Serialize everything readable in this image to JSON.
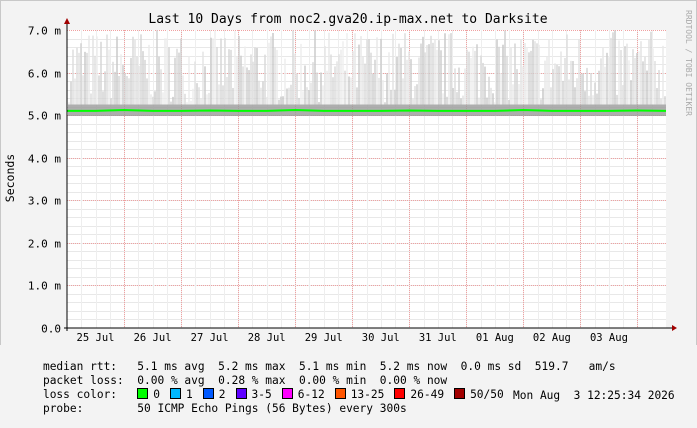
{
  "chart_data": {
    "type": "line",
    "title": "Last 10 Days from noc2.gva20.ip-max.net to Darksite",
    "ylabel": "Seconds",
    "xlabel": "",
    "watermark": "RRDTOOL / TOBI OETIKER",
    "ylim": [
      0,
      7.0
    ],
    "y_ticks": [
      {
        "value": 0,
        "label": "0.0"
      },
      {
        "value": 1,
        "label": "1.0 m"
      },
      {
        "value": 2,
        "label": "2.0 m"
      },
      {
        "value": 3,
        "label": "3.0 m"
      },
      {
        "value": 4,
        "label": "4.0 m"
      },
      {
        "value": 5,
        "label": "5.0 m"
      },
      {
        "value": 6,
        "label": "6.0 m"
      },
      {
        "value": 7,
        "label": "7.0 m"
      }
    ],
    "x_range_days": [
      0,
      10.5
    ],
    "x_ticks": [
      {
        "value": 0.5,
        "label": "25 Jul"
      },
      {
        "value": 1.5,
        "label": "26 Jul"
      },
      {
        "value": 2.5,
        "label": "27 Jul"
      },
      {
        "value": 3.5,
        "label": "28 Jul"
      },
      {
        "value": 4.5,
        "label": "29 Jul"
      },
      {
        "value": 5.5,
        "label": "30 Jul"
      },
      {
        "value": 6.5,
        "label": "31 Jul"
      },
      {
        "value": 7.5,
        "label": "01 Aug"
      },
      {
        "value": 8.5,
        "label": "02 Aug"
      },
      {
        "value": 9.5,
        "label": "03 Aug"
      }
    ],
    "series": [
      {
        "name": "0",
        "color": "#00ff00",
        "x": [
          0,
          0.5,
          1.0,
          1.5,
          2.0,
          2.5,
          3.0,
          3.5,
          4.0,
          4.5,
          5.0,
          5.5,
          6.0,
          6.5,
          7.0,
          7.5,
          8.0,
          8.5,
          9.0,
          9.5,
          10.0,
          10.5
        ],
        "y": [
          5.1,
          5.1,
          5.12,
          5.1,
          5.1,
          5.11,
          5.1,
          5.1,
          5.12,
          5.1,
          5.1,
          5.1,
          5.11,
          5.1,
          5.1,
          5.1,
          5.12,
          5.1,
          5.1,
          5.1,
          5.11,
          5.1
        ]
      }
    ]
  },
  "stats": {
    "median_rtt": {
      "label": "median rtt:",
      "avg": "5.1 ms avg",
      "max": "5.2 ms max",
      "min": "5.1 ms min",
      "now": "5.2 ms now",
      "sd": "0.0 ms sd",
      "jitter": "519.7   am/s"
    },
    "packet_loss": {
      "label": "packet loss:",
      "avg": "0.00 % avg",
      "max": "0.28 % max",
      "min": "0.00 % min",
      "now": "0.00 % now"
    },
    "loss_color": {
      "label": "loss color:",
      "items": [
        {
          "label": "0",
          "color": "#00ff00"
        },
        {
          "label": "1",
          "color": "#00b8ff"
        },
        {
          "label": "2",
          "color": "#0059ff"
        },
        {
          "label": "3-5",
          "color": "#5e00ff"
        },
        {
          "label": "6-12",
          "color": "#ff00ff"
        },
        {
          "label": "13-25",
          "color": "#ff5500"
        },
        {
          "label": "26-49",
          "color": "#ff0000"
        },
        {
          "label": "50/50",
          "color": "#a10000"
        }
      ]
    },
    "probe": {
      "label": "probe:",
      "text": "50 ICMP Echo Pings (56 Bytes) every 300s",
      "timestamp": "Mon Aug  3 12:25:34 2026"
    }
  }
}
